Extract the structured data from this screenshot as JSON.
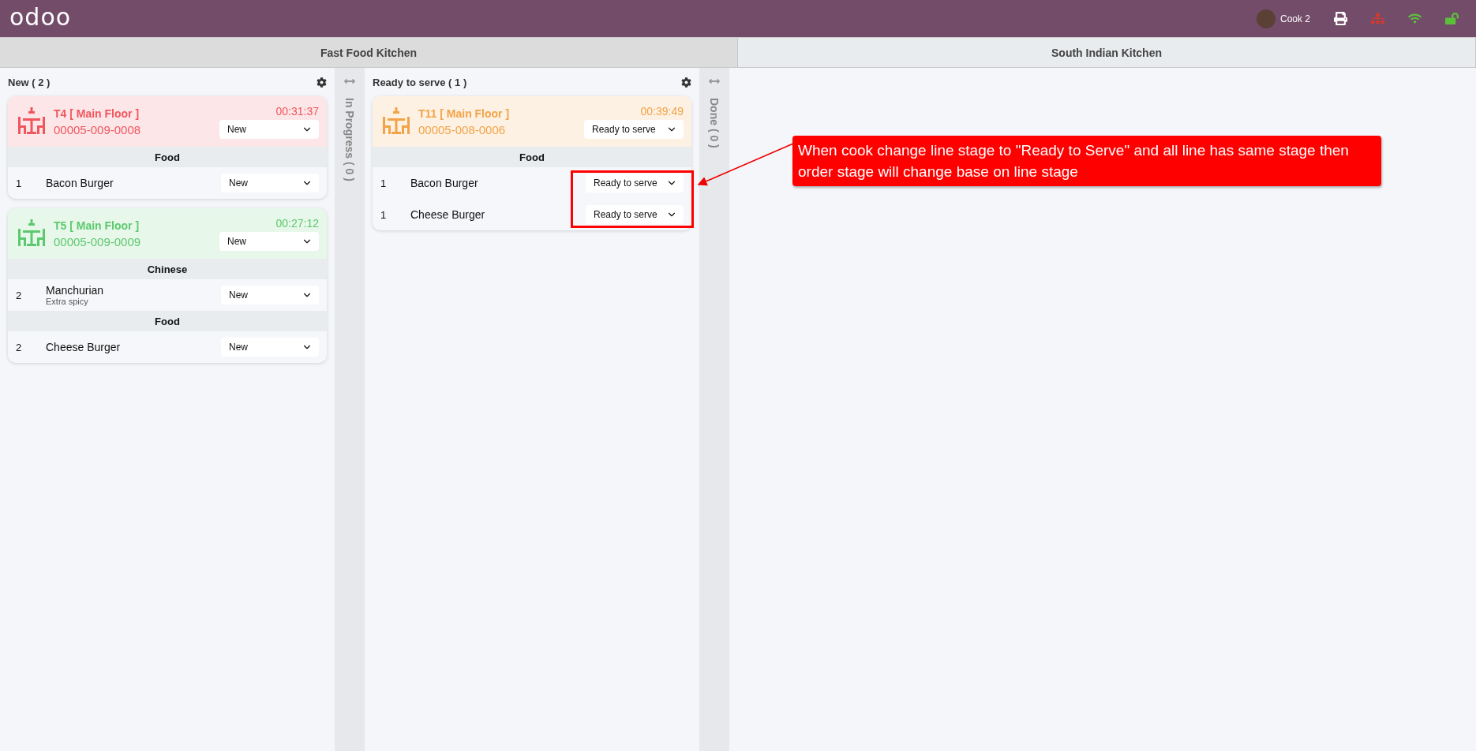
{
  "header": {
    "logo": "odoo",
    "user": "Cook 2"
  },
  "kitchens": [
    {
      "label": "Fast Food Kitchen",
      "selected": true
    },
    {
      "label": "South Indian Kitchen",
      "selected": false
    }
  ],
  "columns": [
    {
      "kind": "expanded",
      "title": "New ( 2 )",
      "orders": [
        {
          "table": "T4 [ Main Floor ]",
          "ref": "00005-009-0008",
          "time": "00:31:37",
          "stage": "New",
          "color": "#f0565e",
          "groups": [
            {
              "category": "Food",
              "lines": [
                {
                  "qty": "1",
                  "name": "Bacon Burger",
                  "stage": "New"
                }
              ]
            }
          ]
        },
        {
          "table": "T5 [ Main Floor ]",
          "ref": "00005-009-0009",
          "time": "00:27:12",
          "stage": "New",
          "color": "#5cc96e",
          "groups": [
            {
              "category": "Chinese",
              "lines": [
                {
                  "qty": "2",
                  "name": "Manchurian",
                  "note": "Extra spicy",
                  "stage": "New"
                }
              ]
            },
            {
              "category": "Food",
              "lines": [
                {
                  "qty": "2",
                  "name": "Cheese Burger",
                  "stage": "New"
                }
              ]
            }
          ]
        }
      ]
    },
    {
      "kind": "collapsed",
      "title": "In Progress ( 0 )"
    },
    {
      "kind": "expanded",
      "title": "Ready to serve ( 1 )",
      "orders": [
        {
          "table": "T11 [ Main Floor ]",
          "ref": "00005-008-0006",
          "time": "00:39:49",
          "stage": "Ready to serve",
          "color": "#f3a347",
          "groups": [
            {
              "category": "Food",
              "lines": [
                {
                  "qty": "1",
                  "name": "Bacon Burger",
                  "stage": "Ready to serve"
                },
                {
                  "qty": "1",
                  "name": "Cheese Burger",
                  "stage": "Ready to serve"
                }
              ]
            }
          ]
        }
      ]
    },
    {
      "kind": "collapsed",
      "title": "Done ( 0 )"
    }
  ],
  "annotation": {
    "text": "When cook change line stage to \"Ready to Serve\" and all line has same stage then order stage will change base on line stage"
  }
}
